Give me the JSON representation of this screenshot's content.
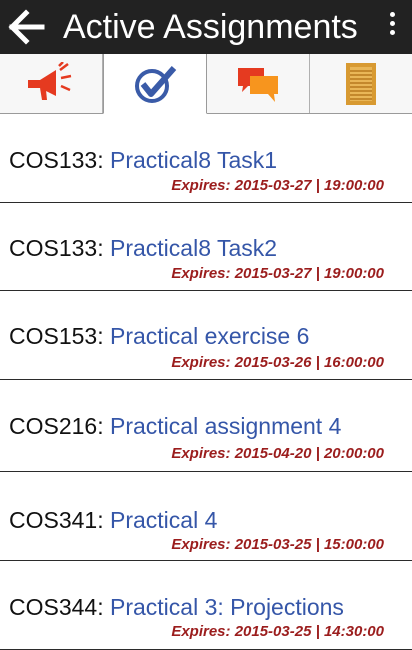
{
  "header": {
    "title": "Active Assignments"
  },
  "tabs": [
    {
      "icon": "megaphone-icon"
    },
    {
      "icon": "checkmark-icon"
    },
    {
      "icon": "chat-bubbles-icon"
    },
    {
      "icon": "notepad-icon"
    }
  ],
  "colors": {
    "app_bar": "#222222",
    "course_link": "#3556a8",
    "expires": "#9b1d1d"
  },
  "assignments": [
    {
      "course": "COS133",
      "separator": ": ",
      "title": "Practical8 Task1",
      "expires": "Expires: 2015-03-27 | 19:00:00"
    },
    {
      "course": "COS133",
      "separator": ": ",
      "title": "Practical8 Task2",
      "expires": "Expires: 2015-03-27 | 19:00:00"
    },
    {
      "course": "COS153",
      "separator": ": ",
      "title": "Practical exercise 6",
      "expires": "Expires: 2015-03-26 | 16:00:00"
    },
    {
      "course": "COS216",
      "separator": ": ",
      "title": "Practical assignment 4",
      "expires": "Expires: 2015-04-20 | 20:00:00"
    },
    {
      "course": "COS341",
      "separator": ": ",
      "title": "Practical 4",
      "expires": "Expires: 2015-03-25 | 15:00:00"
    },
    {
      "course": "COS344",
      "separator": ": ",
      "title": "Practical 3: Projections",
      "expires": "Expires: 2015-03-25 | 14:30:00"
    }
  ]
}
